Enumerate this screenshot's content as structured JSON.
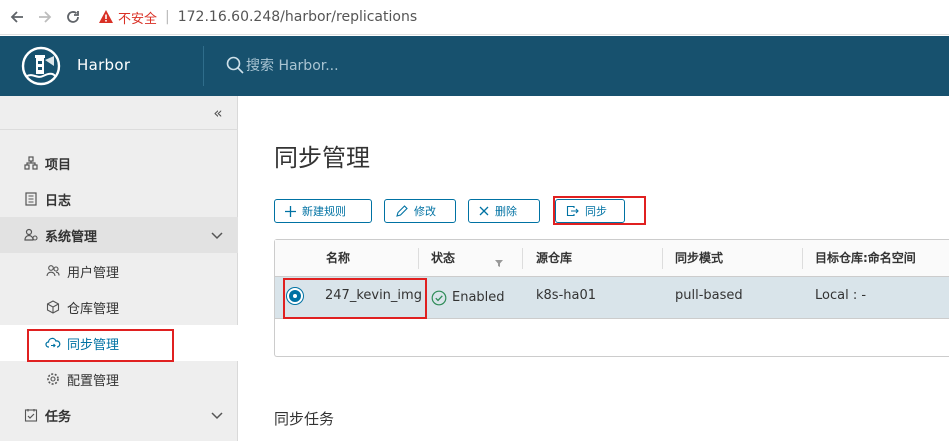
{
  "browser": {
    "insecure_label": "不安全",
    "url": "172.16.60.248/harbor/replications"
  },
  "header": {
    "brand": "Harbor",
    "search_placeholder": "搜索 Harbor..."
  },
  "sidebar": {
    "items": [
      {
        "label": "项目",
        "icon": "project-icon"
      },
      {
        "label": "日志",
        "icon": "log-icon"
      },
      {
        "label": "系统管理",
        "icon": "admin-icon"
      },
      {
        "label": "用户管理",
        "icon": "users-icon"
      },
      {
        "label": "仓库管理",
        "icon": "registry-icon"
      },
      {
        "label": "同步管理",
        "icon": "cloud-sync-icon"
      },
      {
        "label": "配置管理",
        "icon": "gear-icon"
      },
      {
        "label": "任务",
        "icon": "tasks-icon"
      }
    ]
  },
  "main": {
    "title": "同步管理",
    "buttons": {
      "new_rule": "新建规则",
      "edit": "修改",
      "delete": "删除",
      "sync": "同步"
    },
    "grid": {
      "columns": [
        "名称",
        "状态",
        "源仓库",
        "同步模式",
        "目标仓库:命名空间"
      ],
      "rows": [
        {
          "name": "247_kevin_img",
          "status": "Enabled",
          "source": "k8s-ha01",
          "mode": "pull-based",
          "target": "Local : -"
        }
      ]
    },
    "subtitle": "同步任务"
  },
  "colors": {
    "header_bg": "#17516e",
    "accent": "#0072a3",
    "highlight_box": "#e02020",
    "selected_row": "#d9e4ea"
  }
}
